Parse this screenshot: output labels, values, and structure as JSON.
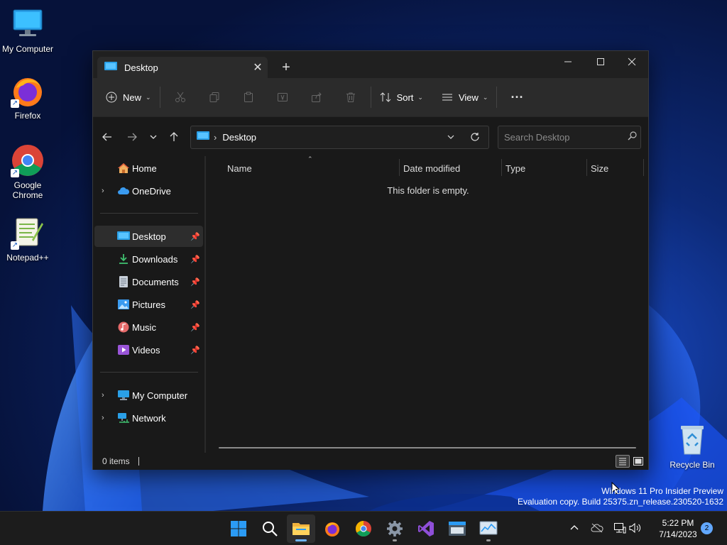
{
  "desktop": {
    "icons": [
      {
        "label": "My Computer"
      },
      {
        "label": "Firefox"
      },
      {
        "label": "Google Chrome"
      },
      {
        "label": "Notepad++"
      },
      {
        "label": "Recycle Bin"
      }
    ]
  },
  "explorer": {
    "tab_title": "Desktop",
    "toolbar": {
      "new_label": "New",
      "sort_label": "Sort",
      "view_label": "View"
    },
    "address": {
      "location": "Desktop",
      "search_placeholder": "Search Desktop"
    },
    "nav": {
      "top": [
        {
          "label": "Home"
        },
        {
          "label": "OneDrive"
        }
      ],
      "quick_access": [
        {
          "label": "Desktop"
        },
        {
          "label": "Downloads"
        },
        {
          "label": "Documents"
        },
        {
          "label": "Pictures"
        },
        {
          "label": "Music"
        },
        {
          "label": "Videos"
        }
      ],
      "bottom": [
        {
          "label": "My Computer"
        },
        {
          "label": "Network"
        }
      ]
    },
    "columns": {
      "name": "Name",
      "date_modified": "Date modified",
      "type": "Type",
      "size": "Size"
    },
    "empty_message": "This folder is empty.",
    "status": "0 items"
  },
  "watermark": {
    "line1": "Windows 11 Pro Insider Preview",
    "line2": "Evaluation copy. Build 25375.zn_release.230520-1632"
  },
  "taskbar": {
    "time": "5:22 PM",
    "date": "7/14/2023",
    "notifications": "2"
  },
  "colors": {
    "accent": "#6cb4ff",
    "window_bg": "#191919",
    "toolbar_bg": "#2b2b2b",
    "taskbar_bg": "#1c1c1c"
  }
}
